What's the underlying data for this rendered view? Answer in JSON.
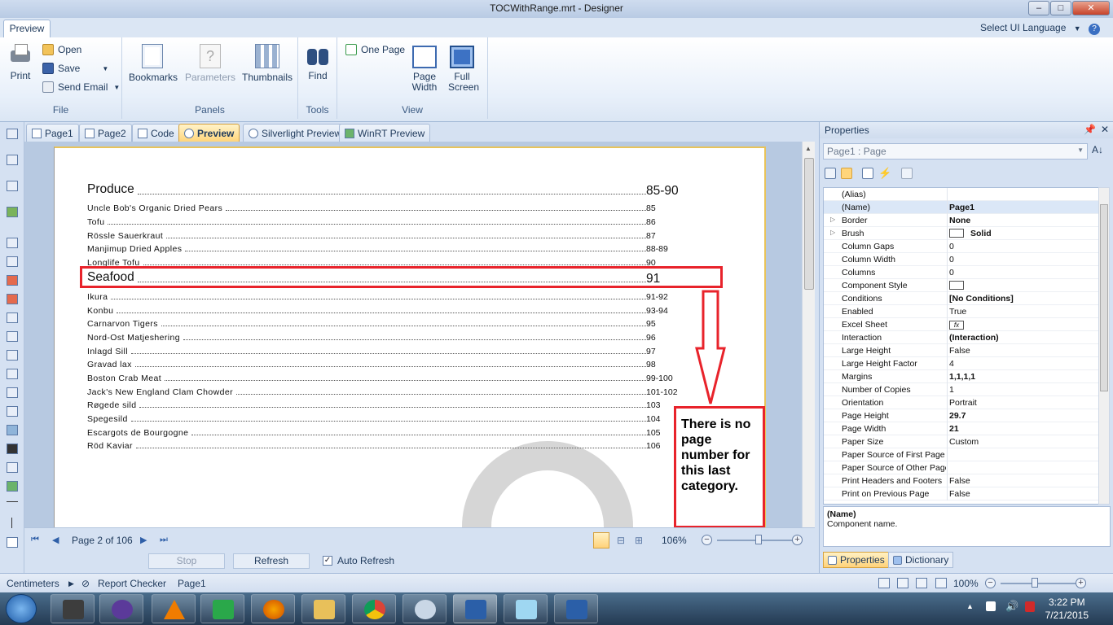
{
  "window": {
    "title": "TOCWithRange.mrt - Designer",
    "min": "–",
    "max": "□",
    "close": "✕"
  },
  "ribbon": {
    "tab": "Preview",
    "select_ui_language": "Select UI Language",
    "groups": {
      "file": {
        "label": "File",
        "print": "Print",
        "open": "Open",
        "save": "Save",
        "send_email": "Send Email"
      },
      "panels": {
        "label": "Panels",
        "bookmarks": "Bookmarks",
        "parameters": "Parameters",
        "thumbnails": "Thumbnails"
      },
      "tools": {
        "label": "Tools",
        "find": "Find"
      },
      "view": {
        "label": "View",
        "one_page": "One Page",
        "page_width": [
          "Page",
          "Width"
        ],
        "full_screen": [
          "Full",
          "Screen"
        ]
      }
    }
  },
  "doc_tabs": [
    "Page1",
    "Page2",
    "Code",
    "Preview",
    "Silverlight Preview",
    "WinRT Preview"
  ],
  "report": {
    "categories": [
      {
        "name": "Produce",
        "pages": "85-90",
        "items": [
          {
            "name": "Uncle Bob's Organic Dried Pears",
            "page": "85"
          },
          {
            "name": "Tofu",
            "page": "86"
          },
          {
            "name": "Rössle Sauerkraut",
            "page": "87"
          },
          {
            "name": "Manjimup Dried Apples",
            "page": "88-89"
          },
          {
            "name": "Longlife Tofu",
            "page": "90"
          }
        ]
      },
      {
        "name": "Seafood",
        "pages": "91",
        "items": [
          {
            "name": "Ikura",
            "page": "91-92"
          },
          {
            "name": "Konbu",
            "page": "93-94"
          },
          {
            "name": "Carnarvon Tigers",
            "page": "95"
          },
          {
            "name": "Nord-Ost Matjeshering",
            "page": "96"
          },
          {
            "name": "Inlagd Sill",
            "page": "97"
          },
          {
            "name": "Gravad lax",
            "page": "98"
          },
          {
            "name": "Boston Crab Meat",
            "page": "99-100"
          },
          {
            "name": "Jack's New England Clam Chowder",
            "page": "101-102"
          },
          {
            "name": "Røgede sild",
            "page": "103"
          },
          {
            "name": "Spegesild",
            "page": "104"
          },
          {
            "name": "Escargots de Bourgogne",
            "page": "105"
          },
          {
            "name": "Röd Kaviar",
            "page": "106"
          }
        ]
      }
    ],
    "callout": "There is no page number for this last category.",
    "annotation_color": "#e8232b"
  },
  "nav": {
    "page_indicator": "Page 2 of 106",
    "zoom": "106%",
    "zoom_level": 0.55
  },
  "actions": {
    "stop": "Stop",
    "refresh": "Refresh",
    "auto_refresh": "Auto Refresh",
    "auto_refresh_checked": true
  },
  "properties": {
    "title": "Properties",
    "selector": "Page1 : Page",
    "rows": [
      {
        "name": "(Alias)",
        "value": ""
      },
      {
        "name": "(Name)",
        "value": "Page1",
        "bold": true
      },
      {
        "name": "Border",
        "value": "None",
        "bold": true,
        "expand": true
      },
      {
        "name": "Brush",
        "value": "Solid",
        "bold": true,
        "expand": true,
        "swatch": true
      },
      {
        "name": "Column Gaps",
        "value": "0"
      },
      {
        "name": "Column Width",
        "value": "0"
      },
      {
        "name": "Columns",
        "value": "0"
      },
      {
        "name": "Component Style",
        "value": "",
        "swatch": true
      },
      {
        "name": "Conditions",
        "value": "[No Conditions]",
        "bold": true
      },
      {
        "name": "Enabled",
        "value": "True"
      },
      {
        "name": "Excel Sheet",
        "value": "",
        "fx": true
      },
      {
        "name": "Interaction",
        "value": "(Interaction)",
        "bold": true
      },
      {
        "name": "Large Height",
        "value": "False"
      },
      {
        "name": "Large Height Factor",
        "value": "4"
      },
      {
        "name": "Margins",
        "value": "1,1,1,1",
        "bold": true
      },
      {
        "name": "Number of Copies",
        "value": "1"
      },
      {
        "name": "Orientation",
        "value": "Portrait"
      },
      {
        "name": "Page Height",
        "value": "29.7",
        "bold": true
      },
      {
        "name": "Page Width",
        "value": "21",
        "bold": true
      },
      {
        "name": "Paper Size",
        "value": "Custom"
      },
      {
        "name": "Paper Source of First Page",
        "value": ""
      },
      {
        "name": "Paper Source of Other Pages",
        "value": ""
      },
      {
        "name": "Print Headers and Footers",
        "value": "False"
      },
      {
        "name": "Print on Previous Page",
        "value": "False"
      }
    ],
    "desc_title": "(Name)",
    "desc_text": "Component name.",
    "tab_properties": "Properties",
    "tab_dictionary": "Dictionary"
  },
  "status": {
    "units": "Centimeters",
    "checker": "Report Checker",
    "page": "Page1",
    "zoom": "100%"
  },
  "taskbar": {
    "time": "3:22 PM",
    "date": "7/21/2015"
  }
}
